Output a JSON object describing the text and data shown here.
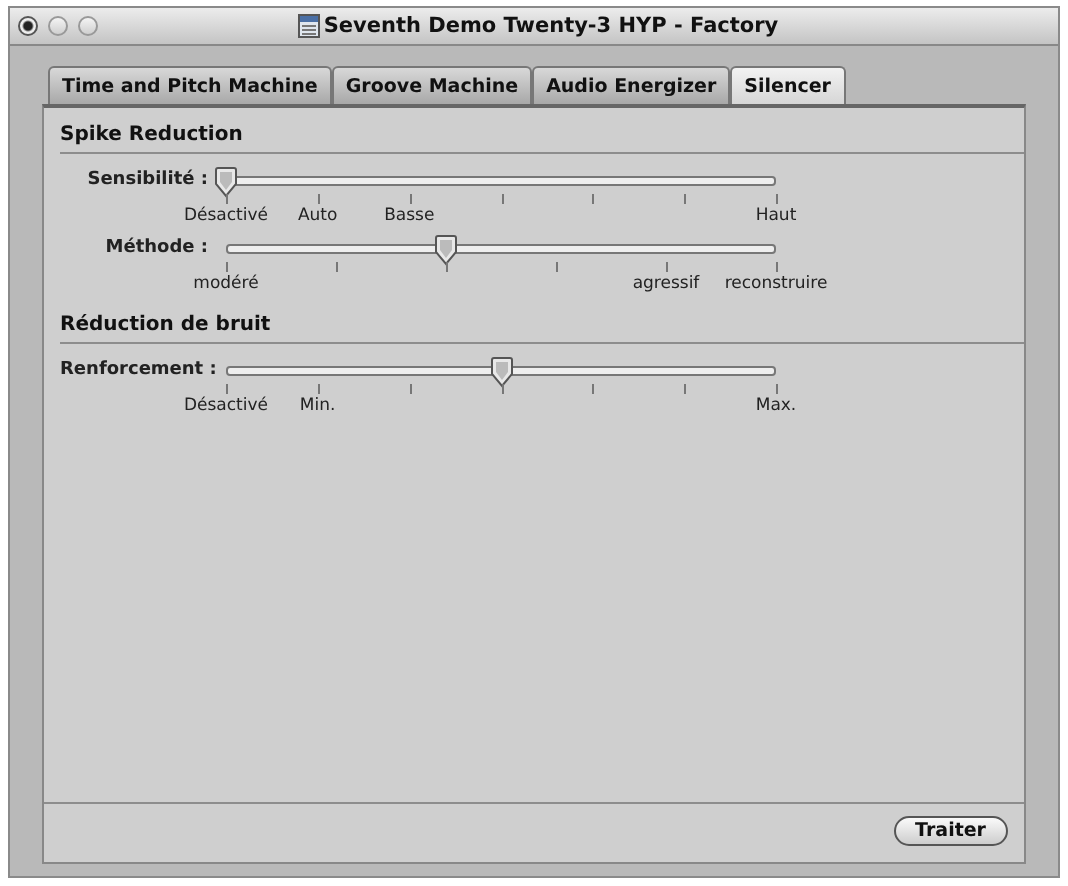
{
  "window": {
    "title": "Seventh Demo Twenty-3 HYP - Factory"
  },
  "tabs": [
    {
      "label": "Time and Pitch Machine",
      "selected": false
    },
    {
      "label": "Groove Machine",
      "selected": false
    },
    {
      "label": "Audio Energizer",
      "selected": false
    },
    {
      "label": "Silencer",
      "selected": true
    }
  ],
  "sections": [
    {
      "title": "Spike Reduction",
      "sliders": [
        {
          "label": "Sensibilité :",
          "level": 0,
          "ticks": [
            {
              "kind": "labeled",
              "label": "Désactivé"
            },
            {
              "kind": "labeled",
              "label": "Auto"
            },
            {
              "kind": "labeled",
              "label": "Basse"
            },
            {
              "kind": "plain"
            },
            {
              "kind": "plain"
            },
            {
              "kind": "plain"
            },
            {
              "kind": "labeled",
              "label": "Haut"
            }
          ]
        },
        {
          "label": "Méthode :",
          "level": 0.4,
          "ticks": [
            {
              "kind": "labeled",
              "label": "modéré"
            },
            {
              "kind": "plain"
            },
            {
              "kind": "plain"
            },
            {
              "kind": "plain"
            },
            {
              "kind": "labeled",
              "label": "agressif"
            },
            {
              "kind": "labeled",
              "label": "reconstruire"
            }
          ]
        }
      ]
    },
    {
      "title": "Réduction de bruit",
      "sliders": [
        {
          "label": "Renforcement :",
          "level": 0.5,
          "ticks": [
            {
              "kind": "labeled",
              "label": "Désactivé"
            },
            {
              "kind": "labeled",
              "label": "Min."
            },
            {
              "kind": "plain"
            },
            {
              "kind": "plain"
            },
            {
              "kind": "plain"
            },
            {
              "kind": "plain"
            },
            {
              "kind": "labeled",
              "label": "Max."
            }
          ]
        }
      ]
    }
  ],
  "buttons": [
    {
      "label": "Traiter"
    }
  ]
}
